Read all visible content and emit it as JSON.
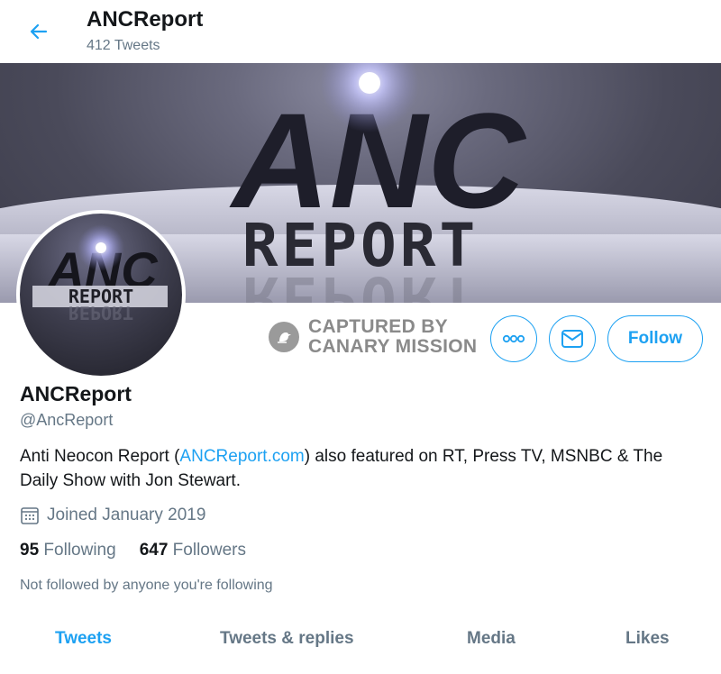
{
  "header": {
    "title": "ANCReport",
    "tweet_count": "412 Tweets"
  },
  "banner": {
    "logo_main": "ANC",
    "logo_sub": "REPORT"
  },
  "avatar": {
    "logo_main": "ANC",
    "logo_sub": "REPORT"
  },
  "canary": {
    "line1": "CAPTURED BY",
    "line2": "CANARY MISSION"
  },
  "actions": {
    "follow_label": "Follow"
  },
  "profile": {
    "name": "ANCReport",
    "handle": "@AncReport",
    "bio_prefix": "Anti Neocon Report (",
    "bio_link": "ANCReport.com",
    "bio_suffix": ")  also featured on RT, Press TV, MSNBC & The Daily Show with Jon Stewart.",
    "joined": "Joined January 2019",
    "following_count": "95",
    "following_label": "Following",
    "followers_count": "647",
    "followers_label": "Followers",
    "not_followed": "Not followed by anyone you're following"
  },
  "tabs": [
    {
      "label": "Tweets",
      "active": true
    },
    {
      "label": "Tweets & replies",
      "active": false
    },
    {
      "label": "Media",
      "active": false
    },
    {
      "label": "Likes",
      "active": false
    }
  ],
  "colors": {
    "accent": "#1da1f2",
    "secondary_text": "#657786",
    "primary_text": "#14171a"
  }
}
